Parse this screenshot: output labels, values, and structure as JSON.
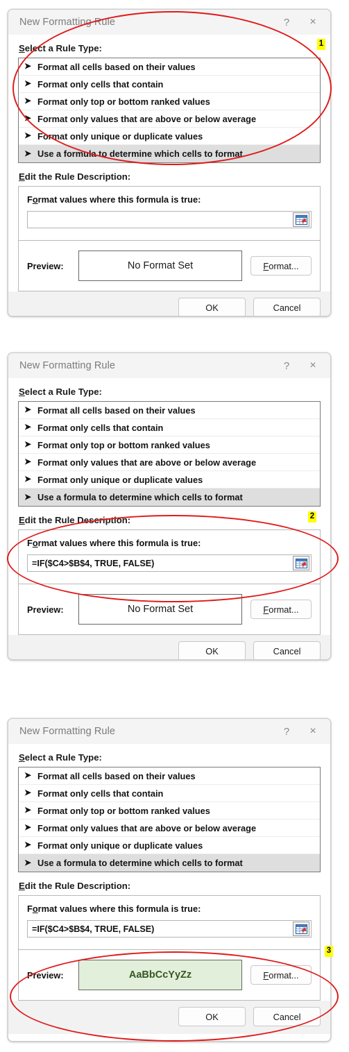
{
  "dialogs": [
    {
      "title": "New Formatting Rule",
      "help_icon": "?",
      "close_icon": "×",
      "rule_type_label_accel": "S",
      "rule_type_label_rest": "elect a Rule Type:",
      "rule_types": [
        {
          "label": "Format all cells based on their values",
          "selected": false
        },
        {
          "label": "Format only cells that contain",
          "selected": false
        },
        {
          "label": "Format only top or bottom ranked values",
          "selected": false
        },
        {
          "label": "Format only values that are above or below average",
          "selected": false
        },
        {
          "label": "Format only unique or duplicate values",
          "selected": false
        },
        {
          "label": "Use a formula to determine which cells to format",
          "selected": true
        }
      ],
      "edit_desc_accel": "E",
      "edit_desc_rest": "dit the Rule Description:",
      "formula_title_accel": "o",
      "formula_title_pre": "F",
      "formula_title_rest": "rmat values where this formula is true:",
      "formula_value": "",
      "formula_placeholder": "",
      "preview_label": "Preview:",
      "preview_text": "No Format Set",
      "preview_formatted": false,
      "format_btn_accel": "F",
      "format_btn_rest": "ormat...",
      "ok_label": "OK",
      "cancel_label": "Cancel"
    },
    {
      "title": "New Formatting Rule",
      "help_icon": "?",
      "close_icon": "×",
      "rule_type_label_accel": "S",
      "rule_type_label_rest": "elect a Rule Type:",
      "rule_types": [
        {
          "label": "Format all cells based on their values",
          "selected": false
        },
        {
          "label": "Format only cells that contain",
          "selected": false
        },
        {
          "label": "Format only top or bottom ranked values",
          "selected": false
        },
        {
          "label": "Format only values that are above or below average",
          "selected": false
        },
        {
          "label": "Format only unique or duplicate values",
          "selected": false
        },
        {
          "label": "Use a formula to determine which cells to format",
          "selected": true
        }
      ],
      "edit_desc_accel": "E",
      "edit_desc_rest": "dit the Rule Description:",
      "formula_title_accel": "o",
      "formula_title_pre": "F",
      "formula_title_rest": "rmat values where this formula is true:",
      "formula_value": "=IF($C4>$B$4, TRUE, FALSE)",
      "formula_placeholder": "",
      "preview_label": "Preview:",
      "preview_text": "No Format Set",
      "preview_formatted": false,
      "format_btn_accel": "F",
      "format_btn_rest": "ormat...",
      "ok_label": "OK",
      "cancel_label": "Cancel"
    },
    {
      "title": "New Formatting Rule",
      "help_icon": "?",
      "close_icon": "×",
      "rule_type_label_accel": "S",
      "rule_type_label_rest": "elect a Rule Type:",
      "rule_types": [
        {
          "label": "Format all cells based on their values",
          "selected": false
        },
        {
          "label": "Format only cells that contain",
          "selected": false
        },
        {
          "label": "Format only top or bottom ranked values",
          "selected": false
        },
        {
          "label": "Format only values that are above or below average",
          "selected": false
        },
        {
          "label": "Format only unique or duplicate values",
          "selected": false
        },
        {
          "label": "Use a formula to determine which cells to format",
          "selected": true
        }
      ],
      "edit_desc_accel": "E",
      "edit_desc_rest": "dit the Rule Description:",
      "formula_title_accel": "o",
      "formula_title_pre": "F",
      "formula_title_rest": "rmat values where this formula is true:",
      "formula_value": "=IF($C4>$B$4, TRUE, FALSE)",
      "formula_placeholder": "",
      "preview_label": "Preview:",
      "preview_text": "AaBbCcYyZz",
      "preview_formatted": true,
      "format_btn_accel": "F",
      "format_btn_rest": "ormat...",
      "ok_label": "OK",
      "cancel_label": "Cancel"
    }
  ],
  "annotations": {
    "badges": [
      "1",
      "2",
      "3"
    ]
  },
  "colors": {
    "annotation_red": "#e01b1b",
    "badge_yellow": "#ffff00",
    "preview_fill_green": "#e2efda",
    "preview_text_green": "#375623",
    "selected_row_gray": "#dedede"
  },
  "icons": {
    "bullet": "➤",
    "range_picker": "range-picker-icon"
  }
}
